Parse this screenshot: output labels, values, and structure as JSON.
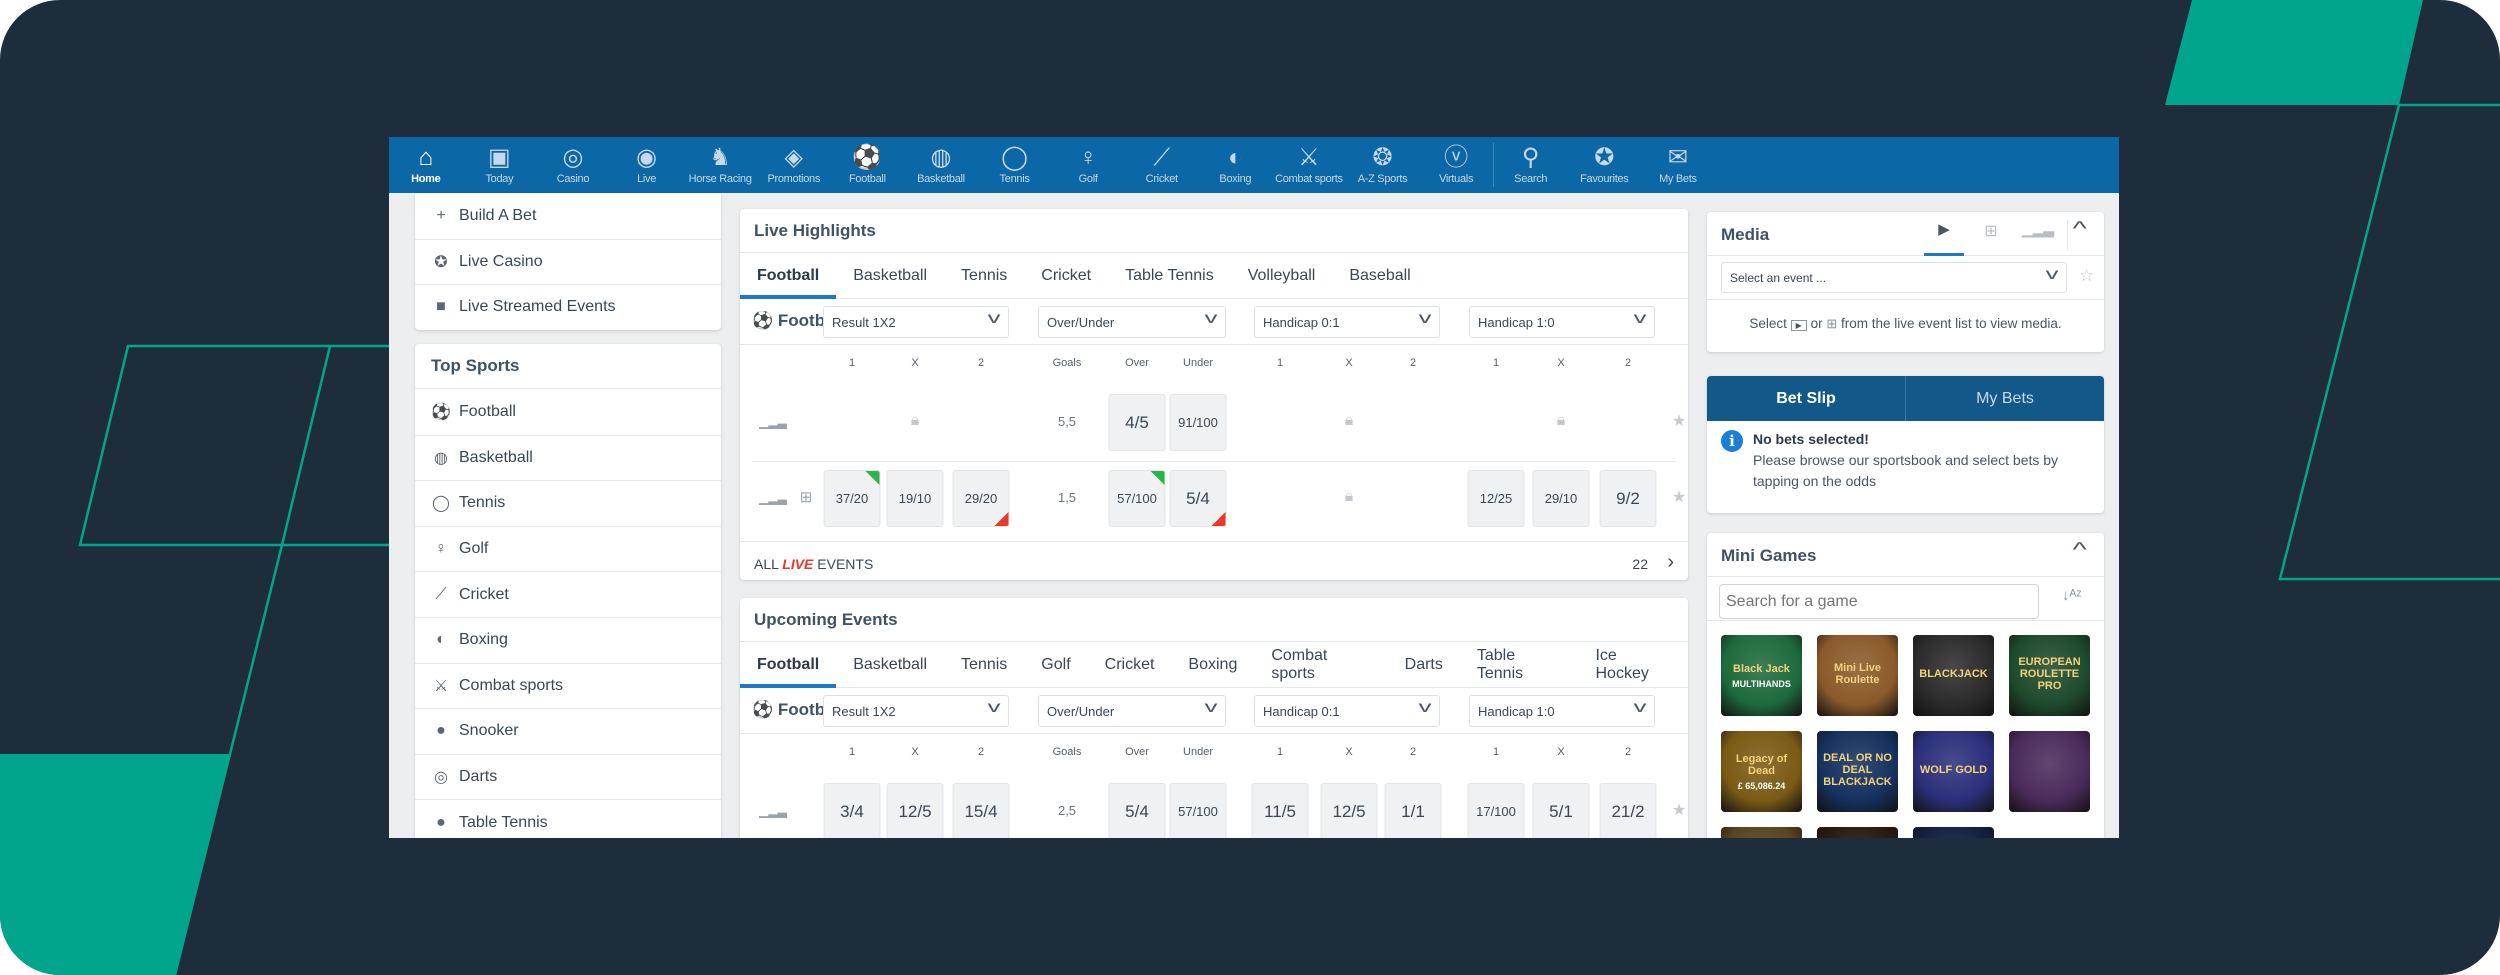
{
  "colors": {
    "nav": "#0b67a6",
    "accent": "#1a79c9",
    "betslip": "#12598a",
    "teal": "#00a58c",
    "frame": "#1e2d3c"
  },
  "nav": [
    {
      "label": "Home",
      "icon": "home-icon",
      "active": true
    },
    {
      "label": "Today",
      "icon": "calendar-icon"
    },
    {
      "label": "Casino",
      "icon": "casino-chip-icon"
    },
    {
      "label": "Live",
      "icon": "live-broadcast-icon"
    },
    {
      "label": "Horse Racing",
      "icon": "horse-icon"
    },
    {
      "label": "Promotions",
      "icon": "ticket-icon"
    },
    {
      "label": "Football",
      "icon": "football-icon"
    },
    {
      "label": "Basketball",
      "icon": "basketball-icon"
    },
    {
      "label": "Tennis",
      "icon": "tennis-ball-icon"
    },
    {
      "label": "Golf",
      "icon": "golf-icon"
    },
    {
      "label": "Cricket",
      "icon": "cricket-icon"
    },
    {
      "label": "Boxing",
      "icon": "boxing-glove-icon"
    },
    {
      "label": "Combat sports",
      "icon": "combat-icon"
    },
    {
      "label": "A-Z Sports",
      "icon": "az-sports-icon"
    },
    {
      "label": "Virtuals",
      "icon": "virtuals-icon"
    },
    {
      "label": "Search",
      "icon": "search-icon"
    },
    {
      "label": "Favourites",
      "icon": "star-icon"
    },
    {
      "label": "My Bets",
      "icon": "my-bets-icon"
    }
  ],
  "quick_links": [
    {
      "label": "Build A Bet",
      "icon": "plus-icon"
    },
    {
      "label": "Live Casino",
      "icon": "casino-icon"
    },
    {
      "label": "Live Streamed Events",
      "icon": "video-camera-icon"
    }
  ],
  "top_sports": {
    "title": "Top Sports",
    "items": [
      {
        "label": "Football",
        "icon": "football-icon"
      },
      {
        "label": "Basketball",
        "icon": "basketball-icon"
      },
      {
        "label": "Tennis",
        "icon": "tennis-ball-icon"
      },
      {
        "label": "Golf",
        "icon": "golf-icon"
      },
      {
        "label": "Cricket",
        "icon": "cricket-icon"
      },
      {
        "label": "Boxing",
        "icon": "boxing-glove-icon"
      },
      {
        "label": "Combat sports",
        "icon": "combat-icon"
      },
      {
        "label": "Snooker",
        "icon": "snooker-icon"
      },
      {
        "label": "Darts",
        "icon": "darts-icon"
      },
      {
        "label": "Table Tennis",
        "icon": "table-tennis-icon"
      }
    ]
  },
  "live": {
    "title": "Live Highlights",
    "tabs": [
      "Football",
      "Basketball",
      "Tennis",
      "Cricket",
      "Table Tennis",
      "Volleyball",
      "Baseball"
    ],
    "sport": "Football",
    "markets": [
      "Result 1X2",
      "Over/Under",
      "Handicap 0:1",
      "Handicap 1:0"
    ],
    "columns": [
      "1",
      "X",
      "2",
      "Goals",
      "Over",
      "Under",
      "1",
      "X",
      "2",
      "1",
      "X",
      "2"
    ],
    "rows": [
      {
        "cells": [
          "lock",
          "",
          "",
          "5,5",
          "4/5",
          "91/100",
          "lock",
          "",
          "",
          "lock",
          "",
          ""
        ],
        "pitch": false,
        "trend": {}
      },
      {
        "cells": [
          "37/20",
          "19/10",
          "29/20",
          "1,5",
          "57/100",
          "5/4",
          "lock",
          "",
          "",
          "12/25",
          "29/10",
          "9/2"
        ],
        "pitch": true,
        "trend": {
          "0": "up",
          "2": "down",
          "4": "up",
          "5": "down"
        }
      }
    ],
    "all_events": {
      "prefix": "ALL",
      "live": "LIVE",
      "suffix": "EVENTS",
      "count": "22"
    }
  },
  "upcoming": {
    "title": "Upcoming Events",
    "tabs": [
      "Football",
      "Basketball",
      "Tennis",
      "Golf",
      "Cricket",
      "Boxing",
      "Combat sports",
      "Darts",
      "Table Tennis",
      "Ice Hockey"
    ],
    "sport": "Football",
    "markets": [
      "Result 1X2",
      "Over/Under",
      "Handicap 0:1",
      "Handicap 1:0"
    ],
    "columns": [
      "1",
      "X",
      "2",
      "Goals",
      "Over",
      "Under",
      "1",
      "X",
      "2",
      "1",
      "X",
      "2"
    ],
    "rows": [
      {
        "cells": [
          "3/4",
          "12/5",
          "15/4",
          "2,5",
          "5/4",
          "57/100",
          "11/5",
          "12/5",
          "1/1",
          "17/100",
          "5/1",
          "21/2"
        ],
        "pitch": false,
        "trend": {}
      }
    ]
  },
  "media": {
    "title": "Media",
    "select_placeholder": "Select an event ...",
    "hint_select": "Select",
    "hint_or": "or",
    "hint_rest": "from the live event list to view media."
  },
  "betslip": {
    "tab_active": "Bet Slip",
    "tab_other": "My Bets",
    "empty_title": "No bets selected!",
    "empty_text": "Please browse our sportsbook and select bets by tapping on the odds"
  },
  "mini_games": {
    "title": "Mini Games",
    "search_placeholder": "Search for a game",
    "games": [
      {
        "name": "Black Jack",
        "sub": "MULTIHANDS",
        "bg": "#1d6a3c"
      },
      {
        "name": "Mini Live Roulette",
        "sub": "",
        "bg": "#8a5a2a"
      },
      {
        "name": "BLACKJACK",
        "sub": "",
        "bg": "#2b2b2b"
      },
      {
        "name": "EUROPEAN ROULETTE PRO",
        "sub": "",
        "bg": "#1e4a2c"
      },
      {
        "name": "Legacy of Dead",
        "sub": "£ 65,086.24",
        "bg": "#7a5a14"
      },
      {
        "name": "DEAL OR NO DEAL BLACKJACK",
        "sub": "",
        "bg": "#15315e"
      },
      {
        "name": "WOLF GOLD",
        "sub": "",
        "bg": "#2a2f7a"
      },
      {
        "name": "",
        "sub": "",
        "bg": "#4a2a5a"
      },
      {
        "name": "",
        "sub": "",
        "bg": "#5a4420"
      },
      {
        "name": "",
        "sub": "",
        "bg": "#2a1a14"
      },
      {
        "name": "",
        "sub": "",
        "bg": "#142040"
      }
    ]
  }
}
